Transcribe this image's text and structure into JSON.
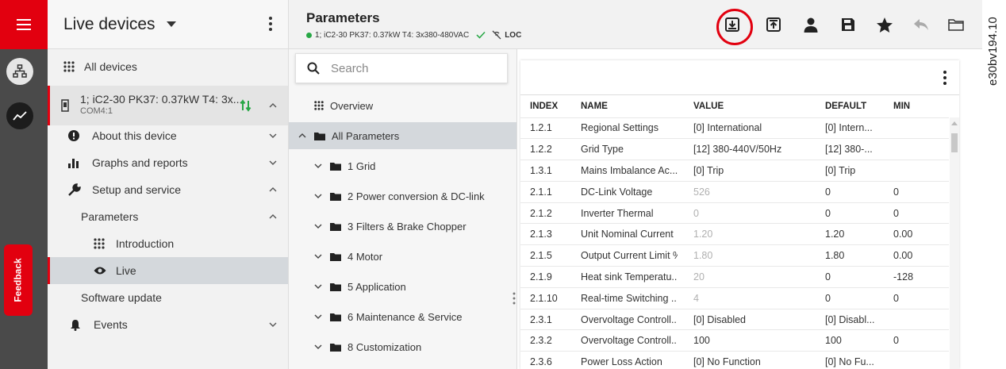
{
  "device_panel": {
    "title": "Live devices",
    "all_devices": "All devices",
    "device_name": "1; iC2-30 PK37: 0.37kW T4: 3x...",
    "device_port": "COM4:1",
    "items": [
      {
        "label": "About this device"
      },
      {
        "label": "Graphs and reports"
      },
      {
        "label": "Setup and service"
      },
      {
        "label": "Parameters"
      },
      {
        "label": "Introduction"
      },
      {
        "label": "Live"
      },
      {
        "label": "Software update"
      },
      {
        "label": "Events"
      }
    ]
  },
  "feedback_label": "Feedback",
  "header": {
    "title": "Parameters",
    "device_status": "1; iC2-30 PK37: 0.37kW T4: 3x380-480VAC",
    "mode": "LOC"
  },
  "tree": {
    "search_placeholder": "Search",
    "items": [
      {
        "label": "Overview"
      },
      {
        "label": "All Parameters"
      },
      {
        "label": "1 Grid"
      },
      {
        "label": "2 Power conversion & DC-link"
      },
      {
        "label": "3 Filters & Brake Chopper"
      },
      {
        "label": "4 Motor"
      },
      {
        "label": "5 Application"
      },
      {
        "label": "6 Maintenance & Service"
      },
      {
        "label": "8 Customization"
      }
    ]
  },
  "table": {
    "columns": [
      "INDEX",
      "NAME",
      "VALUE",
      "DEFAULT",
      "MIN"
    ],
    "rows": [
      {
        "index": "1.2.1",
        "name": "Regional Settings",
        "value": "[0] International",
        "default": "[0] Intern...",
        "min": ""
      },
      {
        "index": "1.2.2",
        "name": "Grid Type",
        "value": "[12] 380-440V/50Hz",
        "default": "[12] 380-...",
        "min": ""
      },
      {
        "index": "1.3.1",
        "name": "Mains Imbalance Ac...",
        "value": "[0] Trip",
        "default": "[0] Trip",
        "min": ""
      },
      {
        "index": "2.1.1",
        "name": "DC-Link Voltage",
        "value": "526",
        "default": "0",
        "min": "0"
      },
      {
        "index": "2.1.2",
        "name": "Inverter Thermal",
        "value": "0",
        "default": "0",
        "min": "0"
      },
      {
        "index": "2.1.3",
        "name": "Unit Nominal Current",
        "value": "1.20",
        "default": "1.20",
        "min": "0.00"
      },
      {
        "index": "2.1.5",
        "name": "Output Current Limit %",
        "value": "1.80",
        "default": "1.80",
        "min": "0.00"
      },
      {
        "index": "2.1.9",
        "name": "Heat sink Temperatu...",
        "value": "20",
        "default": "0",
        "min": "-128"
      },
      {
        "index": "2.1.10",
        "name": "Real-time Switching ...",
        "value": "4",
        "default": "0",
        "min": "0"
      },
      {
        "index": "2.3.1",
        "name": "Overvoltage Controll...",
        "value": "[0] Disabled",
        "default": "[0] Disabl...",
        "min": ""
      },
      {
        "index": "2.3.2",
        "name": "Overvoltage Controll...",
        "value": "100",
        "default": "100",
        "min": "0"
      },
      {
        "index": "2.3.6",
        "name": "Power Loss Action",
        "value": "[0] No Function",
        "default": "[0] No Fu...",
        "min": ""
      }
    ]
  },
  "watermark": "e30bv194.10",
  "colors": {
    "brand_red": "#e2000f",
    "status_green": "#27a745",
    "selected_row": "#d4d8dc"
  }
}
